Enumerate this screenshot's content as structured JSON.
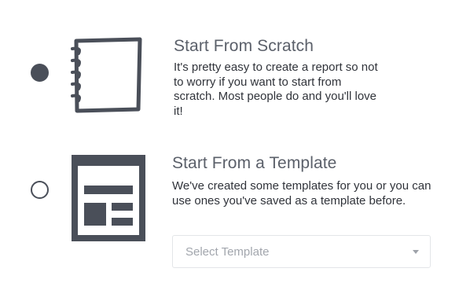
{
  "options": [
    {
      "id": "scratch",
      "title": "Start From Scratch",
      "description": "It's pretty easy to create a report so not to worry if you want to start from scratch. Most people do and you'll love it!",
      "selected": true,
      "icon": "notebook-icon"
    },
    {
      "id": "template",
      "title": "Start From a Template",
      "description": "We've created some templates for you or you can use ones you've saved as a template before.",
      "selected": false,
      "icon": "template-layout-icon"
    }
  ],
  "template_select": {
    "placeholder": "Select Template"
  },
  "colors": {
    "icon": "#4a4f59",
    "title": "#5b606a",
    "text": "#30333a",
    "placeholder": "#a2a6ad",
    "border": "#e3e5e8"
  }
}
